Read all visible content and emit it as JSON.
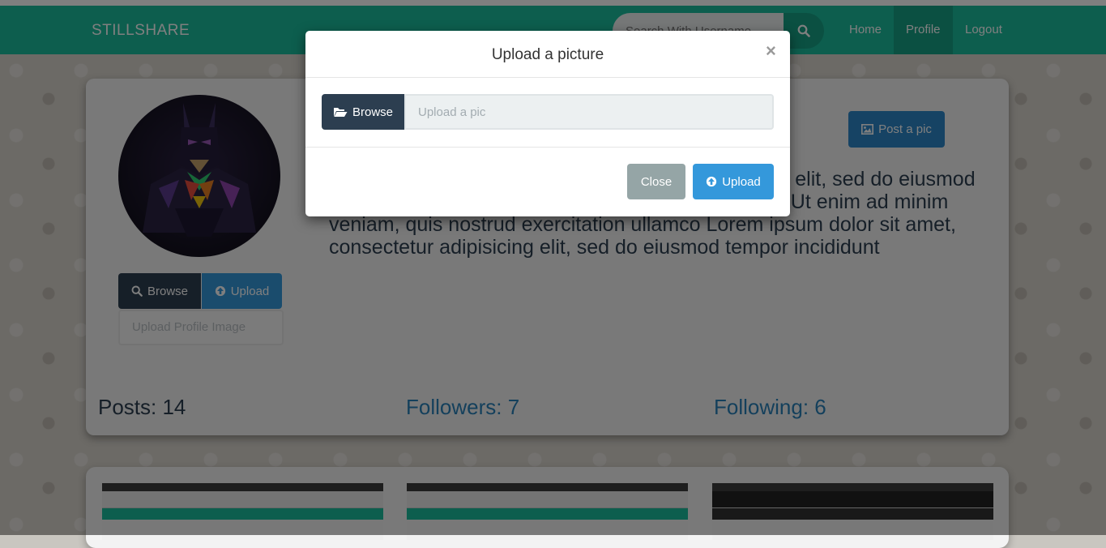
{
  "navbar": {
    "brand": "STILLSHARE",
    "search_placeholder": "Search With Username",
    "items": [
      {
        "label": "Home"
      },
      {
        "label": "Profile"
      },
      {
        "label": "Logout"
      }
    ]
  },
  "profile": {
    "browse_label": "Browse",
    "upload_label": "Upload",
    "file_placeholder": "Upload Profile Image",
    "post_pic_label": "Post a pic",
    "bio": "Lorem ipsum dolor sit amet, consectetur adipisicing elit, sed do eiusmod tempor incididunt ut labore et dolore magna aliqua. Ut enim ad minim veniam, quis nostrud exercitation ullamco Lorem ipsum dolor sit amet, consectetur adipisicing elit, sed do eiusmod tempor incididunt",
    "posts": "Posts: 14",
    "followers": "Followers: 7",
    "following": "Following: 6"
  },
  "modal": {
    "title": "Upload a picture",
    "close_symbol": "×",
    "browse_label": "Browse",
    "file_placeholder": "Upload a pic",
    "close_label": "Close",
    "upload_label": "Upload"
  },
  "colors": {
    "navbar": "#1abc9c",
    "navbar_active": "#16a085",
    "primary": "#3498db",
    "dark": "#2c3e50",
    "muted": "#95a5a6"
  }
}
